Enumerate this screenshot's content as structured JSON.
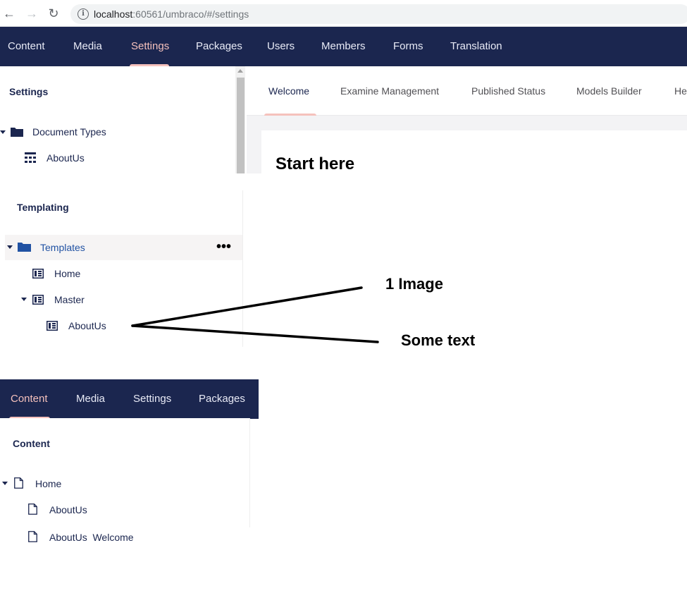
{
  "browser": {
    "url_host": "localhost",
    "url_rest": ":60561/umbraco/#/settings"
  },
  "top_nav": {
    "items": [
      "Content",
      "Media",
      "Settings",
      "Packages",
      "Users",
      "Members",
      "Forms",
      "Translation"
    ],
    "active": "Settings"
  },
  "settings_tree": {
    "title": "Settings",
    "items": [
      {
        "label": "Document Types",
        "icon": "folder-icon"
      },
      {
        "label": "AboutUs",
        "icon": "document-type-icon"
      }
    ]
  },
  "right_panel": {
    "tabs": [
      "Welcome",
      "Examine Management",
      "Published Status",
      "Models Builder",
      "He"
    ],
    "active_tab": "Welcome",
    "heading": "Start here"
  },
  "templating_tree": {
    "title": "Templating",
    "items": [
      {
        "label": "Templates",
        "icon": "folder-icon"
      },
      {
        "label": "Home",
        "icon": "template-icon"
      },
      {
        "label": "Master",
        "icon": "template-icon"
      },
      {
        "label": "AboutUs",
        "icon": "template-icon"
      }
    ],
    "more_actions": "•••"
  },
  "annotations": {
    "label1": "1 Image",
    "label2": "Some text"
  },
  "content_nav": {
    "items": [
      "Content",
      "Media",
      "Settings",
      "Packages"
    ],
    "active": "Content"
  },
  "content_tree": {
    "title": "Content",
    "items": [
      {
        "label": "Home",
        "icon": "document-icon"
      },
      {
        "label": "AboutUs",
        "icon": "document-icon"
      },
      {
        "label": "AboutUs  Welcome",
        "icon": "document-icon"
      }
    ]
  },
  "colors": {
    "nav_bg": "#1b264f",
    "nav_active": "#f5c1bc",
    "tree_text": "#1b264f",
    "link_active": "#2152a3"
  }
}
